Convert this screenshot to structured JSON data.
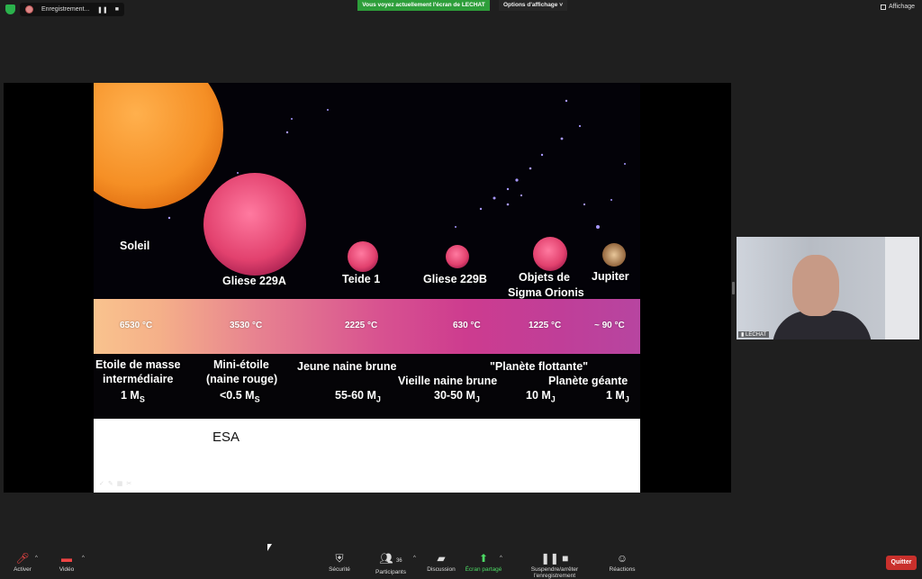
{
  "topbar": {
    "recording_label": "Enregistrement...",
    "pause_icon": "pause-icon",
    "stop_icon": "stop-icon",
    "share_banner": "Vous voyez actuellement l'écran de LECHAT",
    "view_options": "Options d'affichage ˅",
    "layout_label": "Affichage"
  },
  "slide": {
    "labels": {
      "soleil": "Soleil",
      "gliese229a": "Gliese 229A",
      "teide1": "Teide 1",
      "gliese229b": "Gliese 229B",
      "objets_line1": "Objets de",
      "objets_line2": "Sigma Orionis",
      "jupiter": "Jupiter"
    },
    "temps": [
      "6530 °C",
      "3530 °C",
      "2225 °C",
      "630 °C",
      "1225 °C",
      "~ 90 °C"
    ],
    "desc": {
      "etoile_l1": "Etoile de masse",
      "etoile_l2": "intermédiaire",
      "etoile_mass": "1 M",
      "etoile_sub": "S",
      "mini_l1": "Mini-étoile",
      "mini_l2": "(naine rouge)",
      "mini_mass": "<0.5 M",
      "mini_sub": "S",
      "jeune": "Jeune naine brune",
      "jeune_mass": "55-60 M",
      "jeune_sub": "J",
      "vieille": "Vieille naine brune",
      "vieille_mass": "30-50 M",
      "vieille_sub": "J",
      "planete_flottante": "\"Planète flottante\"",
      "pf_mass": "10 M",
      "pf_sub": "J",
      "planete_geante": "Planète géante",
      "pg_mass": "1 M",
      "pg_sub": "J"
    },
    "credit": "ESA"
  },
  "video": {
    "participant_name": "LECHAT"
  },
  "toolbar": {
    "activer": "Activer",
    "video": "Vidéo",
    "securite": "Sécurité",
    "participants": "Participants",
    "participants_count": "36",
    "discussion": "Discussion",
    "ecran_partage": "Écran partagé",
    "recording": "Suspendre/arrêter l'enregistrement",
    "reactions": "Réactions",
    "quitter": "Quitter"
  },
  "colors": {
    "banner_green": "#2d9e3a",
    "quit_red": "#c9302c"
  }
}
